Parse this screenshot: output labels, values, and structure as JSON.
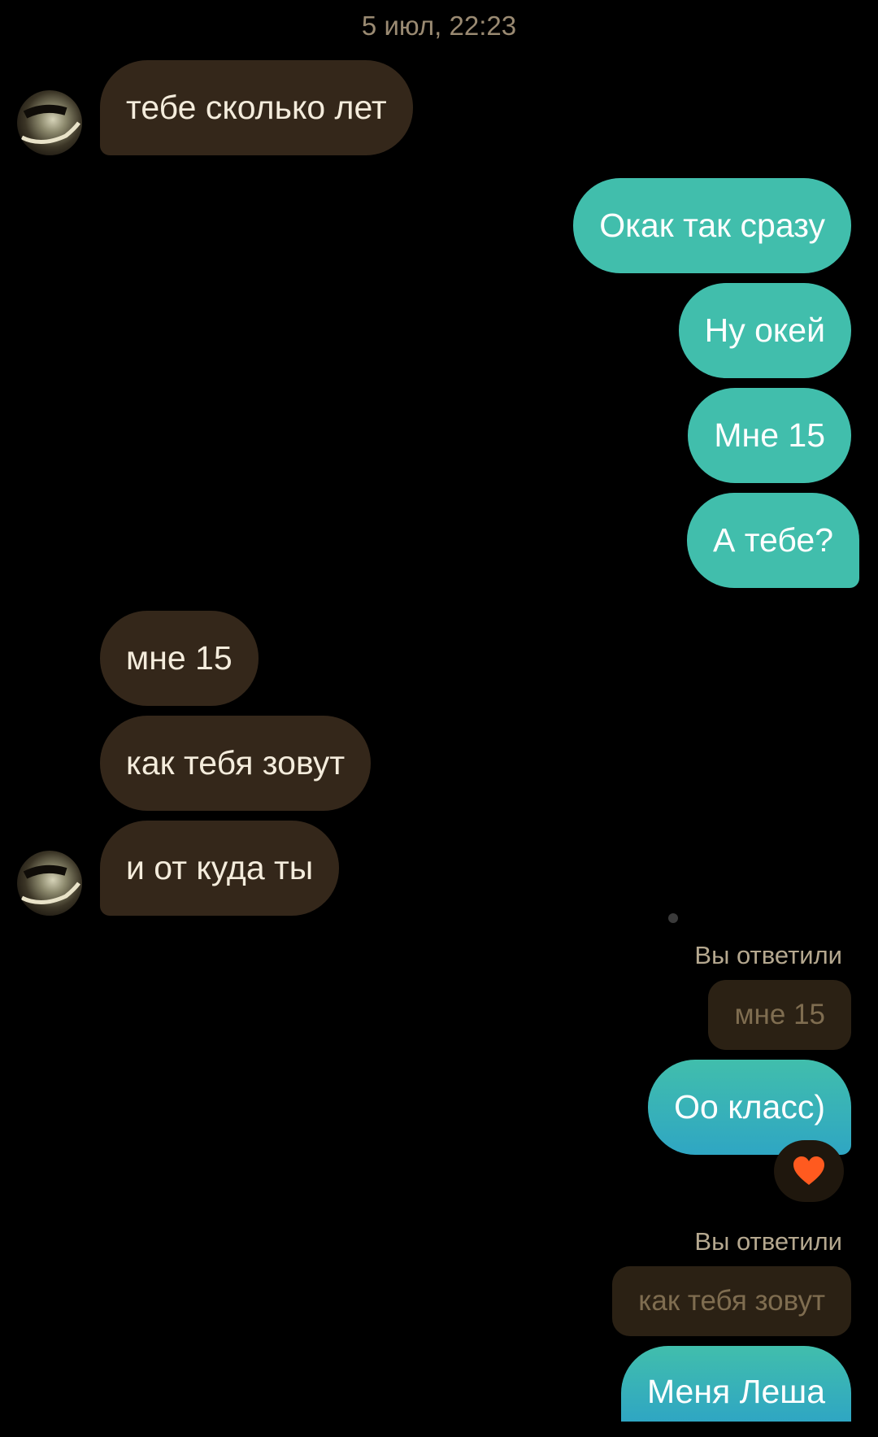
{
  "header": {
    "timestamp": "5 июл, 22:23"
  },
  "messages": [
    {
      "id": "m1",
      "side": "incoming",
      "text": "тебе сколько лет"
    },
    {
      "id": "m2",
      "side": "outgoing",
      "text": "Окак так сразу"
    },
    {
      "id": "m3",
      "side": "outgoing",
      "text": "Ну окей"
    },
    {
      "id": "m4",
      "side": "outgoing",
      "text": "Мне 15"
    },
    {
      "id": "m5",
      "side": "outgoing",
      "text": "А тебе?"
    },
    {
      "id": "m6",
      "side": "incoming",
      "text": "мне 15"
    },
    {
      "id": "m7",
      "side": "incoming",
      "text": "как тебя зовут"
    },
    {
      "id": "m8",
      "side": "incoming",
      "text": "и от куда ты"
    },
    {
      "id": "m9",
      "side": "outgoing",
      "reply_label": "Вы ответили",
      "reply_to": "мне 15",
      "text": "Оо класс)",
      "reaction": "heart"
    },
    {
      "id": "m10",
      "side": "outgoing",
      "reply_label": "Вы ответили",
      "reply_to": "как тебя зовут",
      "text": "Меня Леша"
    }
  ],
  "icons": {
    "avatar": "user-avatar",
    "reaction": "heart-icon"
  },
  "colors": {
    "background": "#000000",
    "incoming_bubble": "#34271a",
    "outgoing_bubble": "#41beac",
    "outgoing_bubble_end": "#2fa6c3",
    "reply_quote": "#2b2114",
    "reaction_heart": "#ff5a1f"
  }
}
